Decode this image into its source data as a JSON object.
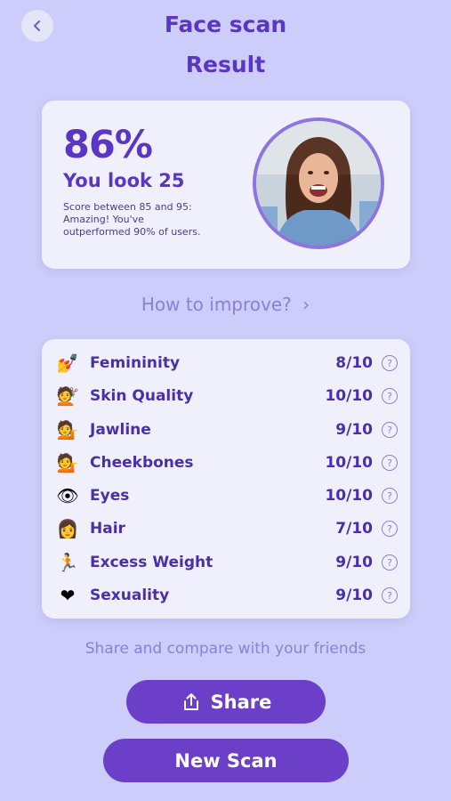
{
  "header": {
    "back_icon": "chevron-left-icon",
    "title": "Face scan",
    "subtitle": "Result"
  },
  "result": {
    "score": "86%",
    "age": "You look 25",
    "description": "Score between 85 and 95: Amazing! You've outperformed 90% of users.",
    "avatar_icon": "user-photo-avatar"
  },
  "improve_link": "How to improve?",
  "metrics": [
    {
      "icon": "nail-polish-icon",
      "label": "Femininity",
      "value": "8/10"
    },
    {
      "icon": "woman-getting-haircut-icon",
      "label": "Skin Quality",
      "value": "10/10"
    },
    {
      "icon": "woman-tipping-hand-icon",
      "label": "Jawline",
      "value": "9/10"
    },
    {
      "icon": "woman-tipping-hand-icon",
      "label": "Cheekbones",
      "value": "10/10"
    },
    {
      "icon": "eye-icon",
      "label": "Eyes",
      "value": "10/10"
    },
    {
      "icon": "woman-face-icon",
      "label": "Hair",
      "value": "7/10"
    },
    {
      "icon": "woman-running-icon",
      "label": "Excess Weight",
      "value": "9/10"
    },
    {
      "icon": "heart-on-fire-icon",
      "label": "Sexuality",
      "value": "9/10"
    }
  ],
  "share_text": "Share and compare with your friends",
  "buttons": {
    "share": "Share",
    "new_scan": "New Scan"
  },
  "colors": {
    "background": "#cccdfa",
    "accent": "#5b35c4",
    "button": "#6b3fc8"
  }
}
